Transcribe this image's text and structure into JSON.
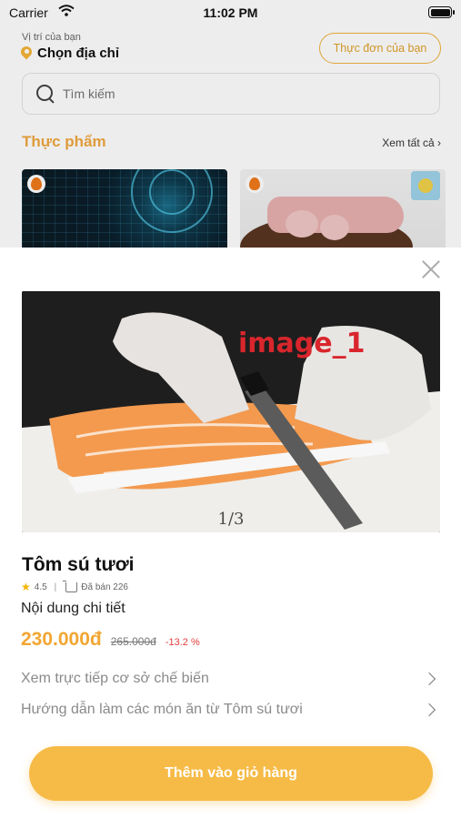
{
  "status_bar": {
    "carrier": "Carrier",
    "time": "11:02 PM"
  },
  "header": {
    "location_label": "Vị trí của bạn",
    "location_value": "Chọn địa chỉ",
    "menu_button": "Thực đơn của bạn"
  },
  "search": {
    "placeholder": "Tìm kiếm"
  },
  "section": {
    "title": "Thực phẩm",
    "see_all": "Xem tất cả"
  },
  "product": {
    "image_watermark": "image_1",
    "image_counter": "1/3",
    "name": "Tôm sú tươi",
    "rating": "4.5",
    "sold": "Đã bán 226",
    "detail_heading": "Nội dung chi tiết",
    "price": "230.000đ",
    "old_price": "265.000đ",
    "discount": "-13.2 %",
    "links": [
      {
        "label": "Xem trực tiếp cơ sở chế biến"
      },
      {
        "label": "Hướng dẫn làm các món ăn từ Tôm sú tươi"
      }
    ],
    "add_to_cart": "Thêm vào giỏ hàng"
  },
  "colors": {
    "accent": "#f6bb47",
    "price": "#f2a632",
    "discount": "#e23c3c"
  },
  "icons": [
    "wifi-icon",
    "battery-icon",
    "location-pin-icon",
    "search-icon",
    "fire-icon",
    "close-icon",
    "star-icon",
    "cart-icon",
    "chevron-right-icon"
  ]
}
